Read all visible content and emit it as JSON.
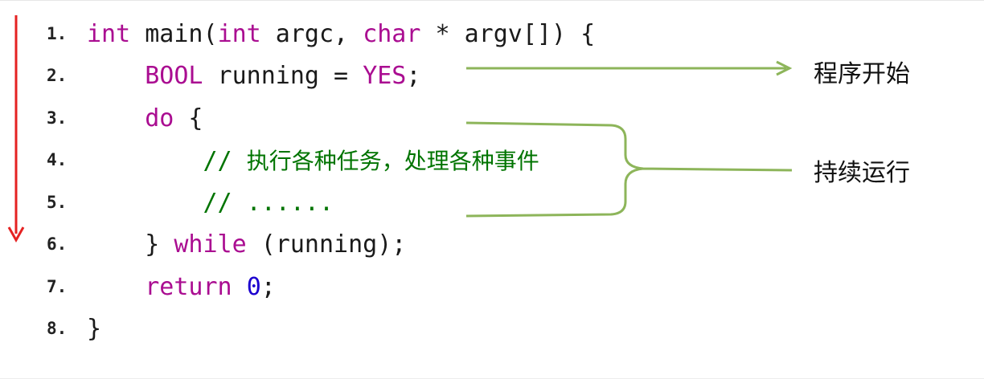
{
  "code": {
    "lines": [
      {
        "n": "1.",
        "t": [
          {
            "k": "kw",
            "v": "int"
          },
          {
            "k": "",
            "v": " main("
          },
          {
            "k": "kw",
            "v": "int"
          },
          {
            "k": "",
            "v": " argc, "
          },
          {
            "k": "kw",
            "v": "char"
          },
          {
            "k": "",
            "v": " * argv[]) {"
          }
        ]
      },
      {
        "n": "2.",
        "t": [
          {
            "k": "",
            "v": "    "
          },
          {
            "k": "kw",
            "v": "BOOL"
          },
          {
            "k": "",
            "v": " running = "
          },
          {
            "k": "kw",
            "v": "YES"
          },
          {
            "k": "",
            "v": ";"
          }
        ]
      },
      {
        "n": "3.",
        "t": [
          {
            "k": "",
            "v": "    "
          },
          {
            "k": "kw",
            "v": "do"
          },
          {
            "k": "",
            "v": " {"
          }
        ]
      },
      {
        "n": "4.",
        "t": [
          {
            "k": "",
            "v": "        "
          },
          {
            "k": "cm",
            "v": "// "
          },
          {
            "k": "cm-zh",
            "v": "执行各种任务，处理各种事件"
          }
        ]
      },
      {
        "n": "5.",
        "t": [
          {
            "k": "",
            "v": "       "
          },
          {
            "k": "cm",
            "v": " // ......"
          }
        ]
      },
      {
        "n": "6.",
        "t": [
          {
            "k": "",
            "v": "    "
          },
          {
            "k": "",
            "v": "} "
          },
          {
            "k": "kw",
            "v": "while"
          },
          {
            "k": "",
            "v": " (running);"
          }
        ]
      },
      {
        "n": "7.",
        "t": [
          {
            "k": "",
            "v": "    "
          },
          {
            "k": "kw",
            "v": "return"
          },
          {
            "k": "",
            "v": " "
          },
          {
            "k": "num-lit",
            "v": "0"
          },
          {
            "k": "",
            "v": ";"
          }
        ]
      },
      {
        "n": "8.",
        "t": [
          {
            "k": "",
            "v": "}"
          }
        ]
      }
    ]
  },
  "annotations": {
    "program_start": "程序开始",
    "keep_running": "持续运行"
  },
  "colors": {
    "keyword": "#aa0d91",
    "comment": "#007400",
    "number": "#1c00cf",
    "arrow_green": "#8db55a",
    "timeline_red": "#e52222"
  }
}
